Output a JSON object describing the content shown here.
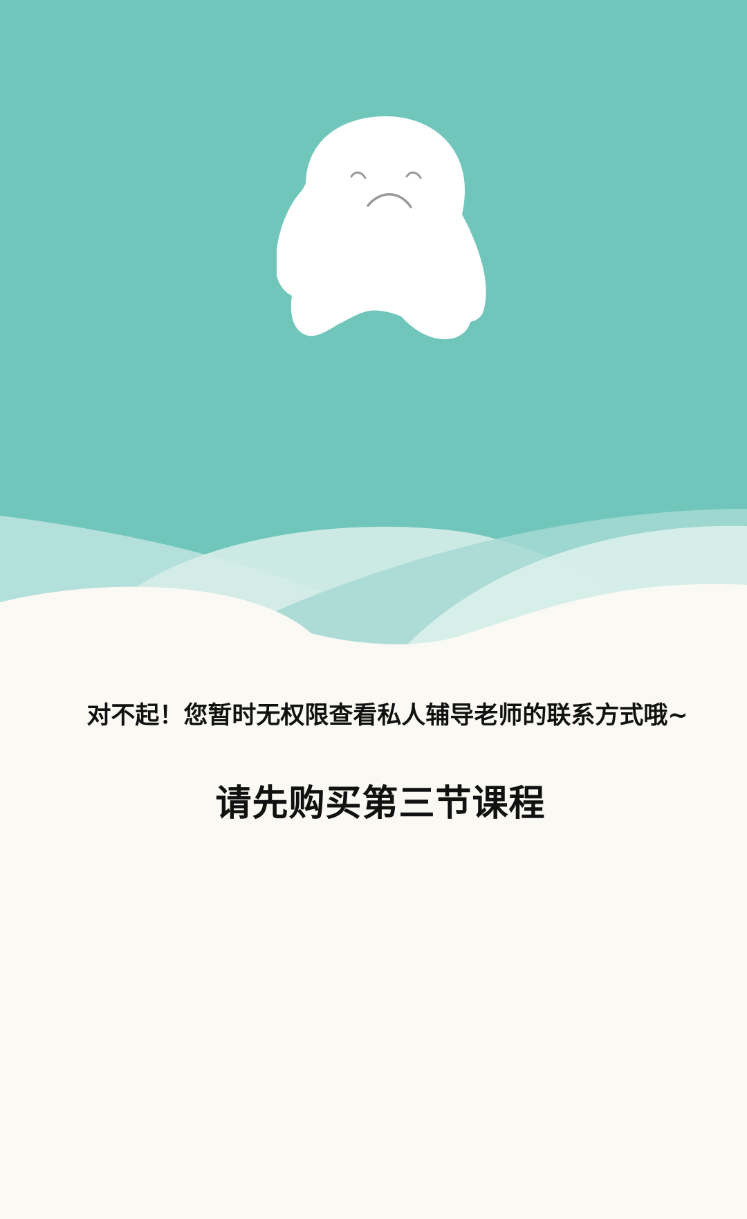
{
  "colors": {
    "teal": "#71c6bb",
    "cream": "#fbf9f4",
    "mascot": "#ffffff",
    "face": "#999999",
    "text": "#111111"
  },
  "mascot": {
    "icon": "sad-ghost-mascot-icon"
  },
  "message": {
    "text": "对不起！您暂时无权限查看私人辅导老师的联系方式哦~"
  },
  "cta": {
    "text": "请先购买第三节课程"
  }
}
